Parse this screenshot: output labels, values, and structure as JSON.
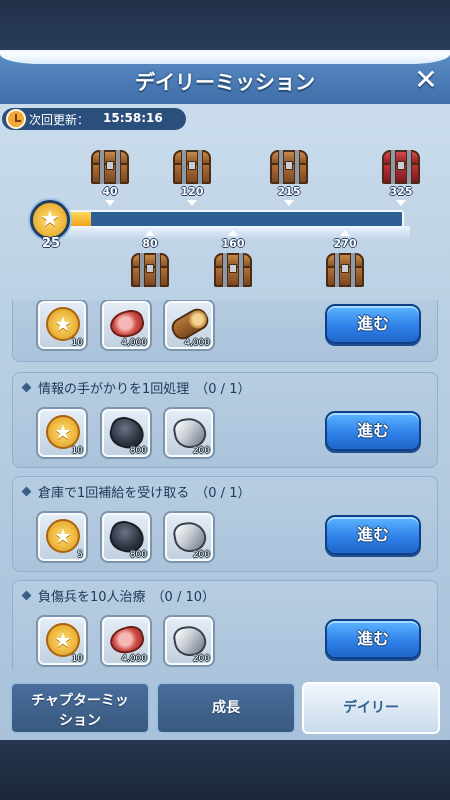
{
  "header": {
    "title": "デイリーミッション",
    "close_symbol": "✕"
  },
  "timer": {
    "label": "次回更新：",
    "value": "15:58:16"
  },
  "progress": {
    "current_points": "25",
    "fraction": 0.073,
    "milestones_top": [
      "40",
      "120",
      "215",
      "325"
    ],
    "milestones_bottom": [
      "80",
      "160",
      "270"
    ]
  },
  "missions": [
    {
      "title": "",
      "count": "",
      "button": "進む",
      "rewards": [
        {
          "icon": "coin-icon",
          "qty": "10"
        },
        {
          "icon": "meat-icon",
          "qty": "4,000"
        },
        {
          "icon": "wood-icon",
          "qty": "4,000"
        }
      ]
    },
    {
      "title": "情報の手がかりを1回処理",
      "count": "（0 / 1）",
      "button": "進む",
      "rewards": [
        {
          "icon": "coin-icon",
          "qty": "10"
        },
        {
          "icon": "coal-icon",
          "qty": "800"
        },
        {
          "icon": "iron-icon",
          "qty": "200"
        }
      ]
    },
    {
      "title": "倉庫で1回補給を受け取る",
      "count": "（0 / 1）",
      "button": "進む",
      "rewards": [
        {
          "icon": "coin-icon",
          "qty": "5"
        },
        {
          "icon": "coal-icon",
          "qty": "800"
        },
        {
          "icon": "iron-icon",
          "qty": "200"
        }
      ]
    },
    {
      "title": "負傷兵を10人治療",
      "count": "（0 / 10）",
      "button": "進む",
      "rewards": [
        {
          "icon": "coin-icon",
          "qty": "10"
        },
        {
          "icon": "meat-icon",
          "qty": "4,000"
        },
        {
          "icon": "iron-icon",
          "qty": "200"
        }
      ]
    }
  ],
  "tabs": [
    {
      "line1": "チャプターミッ",
      "line2": "ション",
      "active": false
    },
    {
      "line1": "成長",
      "line2": "",
      "active": false
    },
    {
      "line1": "デイリー",
      "line2": "",
      "active": true
    }
  ],
  "colors": {
    "accent": "#2c7de6",
    "header": "#4a7db8",
    "bar_fill": "#f5b731"
  }
}
